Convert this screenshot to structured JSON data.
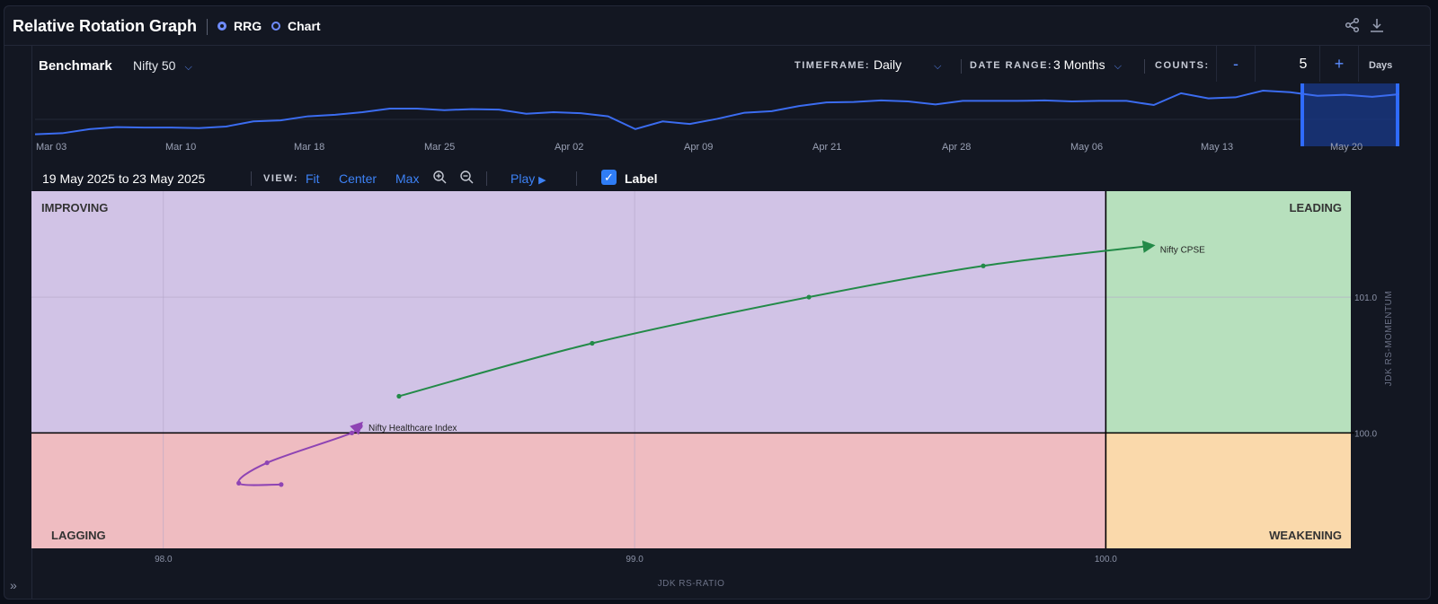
{
  "header": {
    "title": "Relative Rotation Graph",
    "mode_rrg": "RRG",
    "mode_chart": "Chart",
    "share_icon": "share-icon",
    "download_icon": "download-icon"
  },
  "controls": {
    "benchmark_label": "Benchmark",
    "benchmark_value": "Nifty 50",
    "timeframe_label": "TIMEFRAME:",
    "timeframe_value": "Daily",
    "daterange_label": "DATE RANGE:",
    "daterange_value": "3 Months",
    "counts_label": "COUNTS:",
    "counts_minus": "-",
    "counts_value": "5",
    "counts_plus": "+",
    "counts_unit": "Days"
  },
  "navigator": {
    "labels": [
      "Mar 03",
      "Mar 10",
      "Mar 18",
      "Mar 25",
      "Apr 02",
      "Apr 09",
      "Apr 21",
      "Apr 28",
      "May 06",
      "May 13",
      "May 20"
    ],
    "line": [
      0.2,
      0.22,
      0.3,
      0.34,
      0.33,
      0.33,
      0.32,
      0.35,
      0.45,
      0.47,
      0.55,
      0.58,
      0.63,
      0.7,
      0.7,
      0.67,
      0.69,
      0.68,
      0.6,
      0.63,
      0.61,
      0.55,
      0.3,
      0.45,
      0.4,
      0.5,
      0.62,
      0.65,
      0.75,
      0.82,
      0.83,
      0.86,
      0.84,
      0.78,
      0.85,
      0.85,
      0.85,
      0.86,
      0.84,
      0.85,
      0.85,
      0.77,
      1.0,
      0.9,
      0.92,
      1.05,
      1.02,
      0.95,
      0.97,
      0.93,
      0.98
    ],
    "line_color": "#3b6cf0",
    "selection_color": "#1a3a8a"
  },
  "toolbar": {
    "date_range": "19  May  2025 to   23  May  2025",
    "view_label": "VIEW:",
    "fit": "Fit",
    "center": "Center",
    "max": "Max",
    "play": "Play",
    "label_toggle": "Label",
    "label_checked": true
  },
  "chart_data": {
    "type": "scatter",
    "xlabel": "JDK RS-RATIO",
    "ylabel": "JDK RS-MOMENTUM",
    "xlim": [
      97.72,
      100.52
    ],
    "ylim": [
      99.15,
      101.78
    ],
    "x_ticks": [
      98.0,
      99.0,
      100.0
    ],
    "y_ticks": [
      100.0,
      101.0
    ],
    "quadrants": {
      "improving": {
        "label": "IMPROVING",
        "color": "#d1c3e6"
      },
      "leading": {
        "label": "LEADING",
        "color": "#b7e0bd"
      },
      "lagging": {
        "label": "LAGGING",
        "color": "#efbcc1"
      },
      "weakening": {
        "label": "WEAKENING",
        "color": "#fad9ab"
      }
    },
    "series": [
      {
        "name": "Nifty CPSE",
        "color": "#238a48",
        "points": [
          [
            98.5,
            100.27
          ],
          [
            98.91,
            100.66
          ],
          [
            99.37,
            101.0
          ],
          [
            99.74,
            101.23
          ],
          [
            100.1,
            101.38
          ]
        ]
      },
      {
        "name": "Nifty Healthcare Index",
        "color": "#8e44b4",
        "points": [
          [
            98.25,
            99.62
          ],
          [
            98.16,
            99.63
          ],
          [
            98.22,
            99.78
          ],
          [
            98.4,
            100.0
          ],
          [
            98.42,
            100.07
          ]
        ]
      }
    ]
  }
}
